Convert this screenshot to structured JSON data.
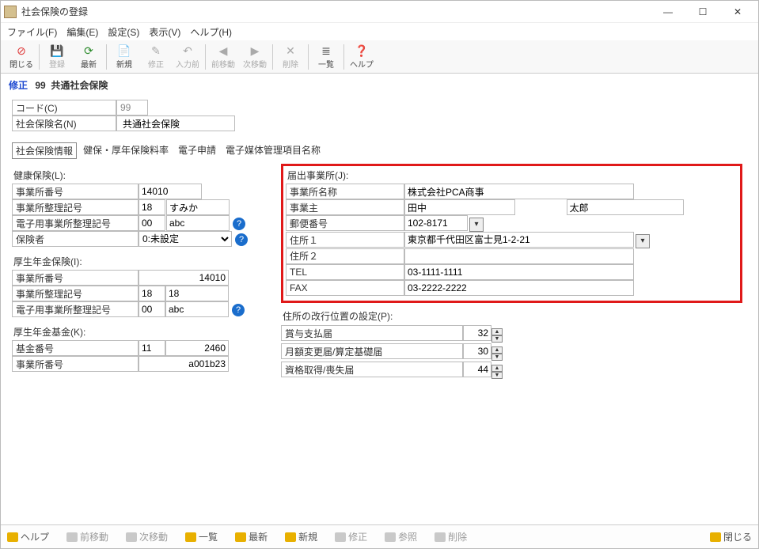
{
  "titlebar": {
    "title": "社会保険の登録"
  },
  "menubar": {
    "file": "ファイル(F)",
    "edit": "編集(E)",
    "settings": "設定(S)",
    "view": "表示(V)",
    "help": "ヘルプ(H)"
  },
  "toolbar": {
    "close": "閉じる",
    "register": "登録",
    "latest": "最新",
    "new": "新規",
    "fix": "修正",
    "inputprev": "入力前",
    "moveprev": "前移動",
    "movenext": "次移動",
    "delete": "削除",
    "list": "一覧",
    "help": "ヘルプ"
  },
  "modeline": {
    "mode": "修正",
    "code": "99",
    "name": "共通社会保険"
  },
  "header": {
    "code_lbl": "コード(C)",
    "code_val": "99",
    "name_lbl": "社会保険名(N)",
    "name_val": "共通社会保険"
  },
  "tabs": {
    "t1": "社会保険情報",
    "t2": "健保・厚年保険料率",
    "t3": "電子申請",
    "t4": "電子媒体管理項目名称"
  },
  "kenpo": {
    "title": "健康保険(L):",
    "office_no_lbl": "事業所番号",
    "office_no": "14010",
    "arrange_lbl": "事業所整理記号",
    "arrange1": "18",
    "arrange2": "すみか",
    "elec_lbl": "電子用事業所整理記号",
    "elec1": "00",
    "elec2": "abc",
    "insurer_lbl": "保険者",
    "insurer": "0:未設定"
  },
  "kosei": {
    "title": "厚生年金保険(I):",
    "office_no_lbl": "事業所番号",
    "office_no": "14010",
    "arrange_lbl": "事業所整理記号",
    "arrange1": "18",
    "arrange2": "18",
    "elec_lbl": "電子用事業所整理記号",
    "elec1": "00",
    "elec2": "abc"
  },
  "kikin": {
    "title": "厚生年金基金(K):",
    "fund_lbl": "基金番号",
    "fund1": "11",
    "fund2": "2460",
    "office_lbl": "事業所番号",
    "office": "a001b23"
  },
  "todokede": {
    "title": "届出事業所(J):",
    "name_lbl": "事業所名称",
    "name": "株式会社PCA商事",
    "owner_lbl": "事業主",
    "owner1": "田中",
    "owner2": "太郎",
    "zip_lbl": "郵便番号",
    "zip": "102-8171",
    "addr1_lbl": "住所１",
    "addr1": "東京都千代田区富士見1-2-21",
    "addr2_lbl": "住所２",
    "addr2": "",
    "tel_lbl": "TEL",
    "tel": "03-1111-1111",
    "fax_lbl": "FAX",
    "fax": "03-2222-2222"
  },
  "kaigyo": {
    "title": "住所の改行位置の設定(P):",
    "bonus_lbl": "賞与支払届",
    "bonus": "32",
    "month_lbl": "月額変更届/算定基礎届",
    "month": "30",
    "status_lbl": "資格取得/喪失届",
    "status": "44"
  },
  "status": {
    "help": "ヘルプ",
    "prev": "前移動",
    "next": "次移動",
    "list": "一覧",
    "latest": "最新",
    "new": "新規",
    "fix": "修正",
    "ref": "参照",
    "del": "削除",
    "close": "閉じる"
  }
}
